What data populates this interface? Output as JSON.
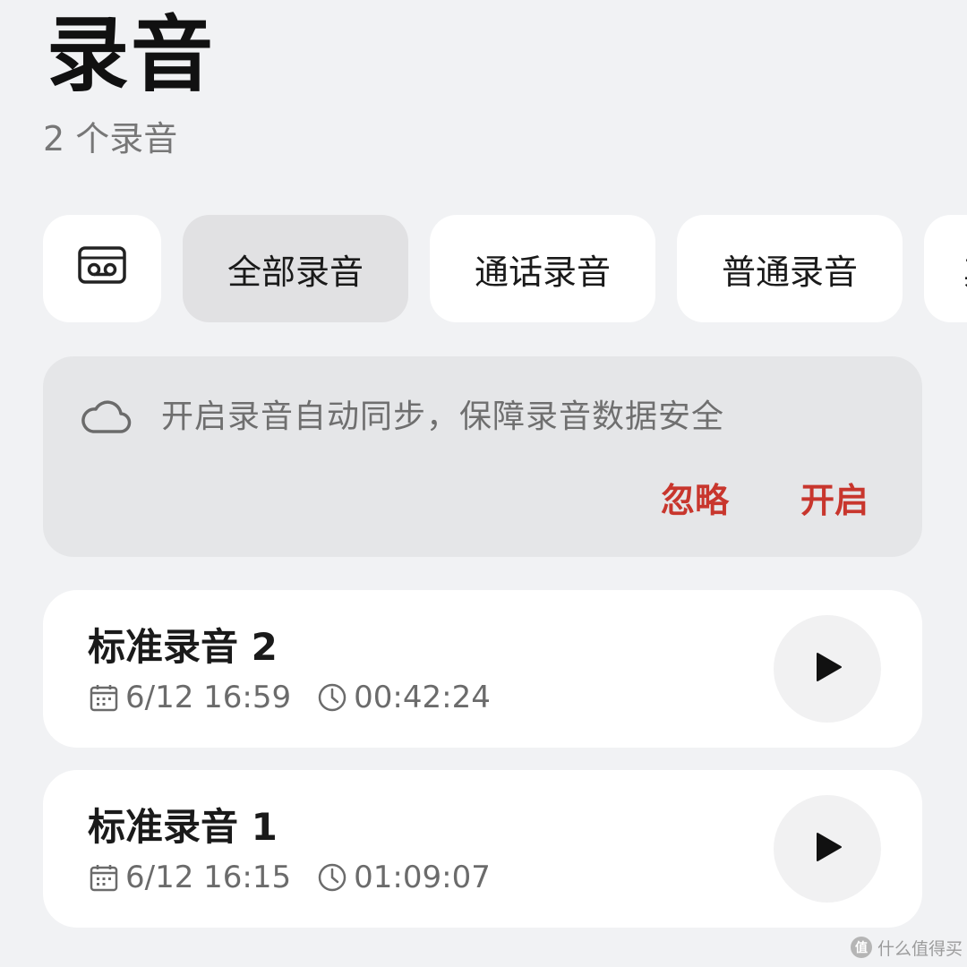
{
  "header": {
    "title": "录音",
    "subtitle": "2 个录音"
  },
  "filters": {
    "icon": "cassette-tape-icon",
    "items": [
      {
        "label": "全部录音",
        "active": true
      },
      {
        "label": "通话录音",
        "active": false
      },
      {
        "label": "普通录音",
        "active": false
      },
      {
        "label": "其",
        "active": false
      }
    ]
  },
  "sync_banner": {
    "icon": "cloud-icon",
    "text": "开启录音自动同步，保障录音数据安全",
    "ignore_label": "忽略",
    "enable_label": "开启",
    "accent_color": "#c8362d"
  },
  "recordings": [
    {
      "name": "标准录音 2",
      "date": "6/12 16:59",
      "duration": "00:42:24"
    },
    {
      "name": "标准录音 1",
      "date": "6/12 16:15",
      "duration": "01:09:07"
    }
  ],
  "watermark": {
    "badge": "值",
    "text": "什么值得买"
  }
}
